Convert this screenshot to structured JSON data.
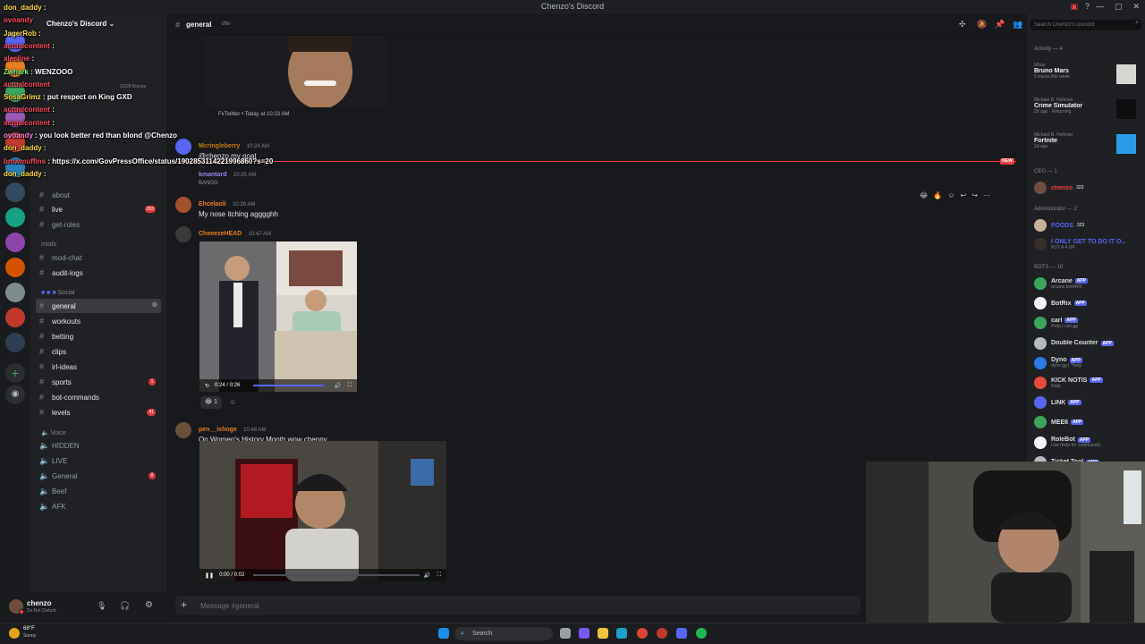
{
  "window": {
    "title": "Chenzo's Discord",
    "controls": [
      "—",
      "▢",
      "✕"
    ]
  },
  "server": {
    "name": "Chenzo's Discord",
    "boost_label": "12/28 Boosts"
  },
  "sidebar": {
    "categories": {
      "mods": "mods",
      "social": "Social",
      "voice": "Voice"
    },
    "top_channels": [
      {
        "name": "about"
      },
      {
        "name": "live",
        "badge": "293"
      },
      {
        "name": "get-roles"
      }
    ],
    "mod_channels": [
      {
        "name": "mod-chat"
      },
      {
        "name": "audit-logs"
      }
    ],
    "social_channels": [
      {
        "name": "general",
        "active": true
      },
      {
        "name": "workouts"
      },
      {
        "name": "betting"
      },
      {
        "name": "clips"
      },
      {
        "name": "irl-ideas"
      },
      {
        "name": "sports",
        "badge": "1"
      },
      {
        "name": "bot-commands"
      },
      {
        "name": "levels",
        "badge": "41"
      }
    ],
    "voice_channels": [
      {
        "name": "HIDDEN"
      },
      {
        "name": "LIVE"
      },
      {
        "name": "General",
        "badge": "8"
      },
      {
        "name": "Beef"
      },
      {
        "name": "AFK"
      }
    ]
  },
  "user_panel": {
    "username": "chenzo",
    "status": "Do Not Disturb"
  },
  "chat": {
    "channel": "general",
    "topic": "dfw",
    "embed_footer": "FxTwitter • Today at 10:23 AM",
    "new_tag": "NEW",
    "messages": [
      {
        "author": "Mcringleberry",
        "time": "10:24 AM",
        "text": "@chenzo my goat",
        "color": "#c27c0e"
      },
      {
        "author": "kmantard",
        "time": "10:25 AM",
        "text": "BANGG",
        "color": "#9b84ee"
      },
      {
        "author": "Ehcelaoli",
        "time": "10:26 AM",
        "text": "My nose itching agggghh",
        "color": "#e67e22"
      },
      {
        "author": "CheeezeHEAD",
        "time": "10:47 AM",
        "text": "",
        "color": "#e67e22"
      },
      {
        "author": "pen__ishoge",
        "time": "10:48 AM",
        "text": "On Women's History Month wow chenny",
        "color": "#e67e22"
      }
    ],
    "video1": {
      "time": "0:24 / 0:26",
      "progress": 0.92
    },
    "reaction": {
      "emoji": "😂",
      "count": "1"
    },
    "video2": {
      "time": "0:00 / 0:02",
      "progress": 0.0
    },
    "composer_placeholder": "Message #general"
  },
  "members": {
    "search_placeholder": "Search Chenzo's Discord",
    "activity_header": "Activity — 4",
    "activity": [
      {
        "name": "Mbae",
        "title": "Bruno Mars",
        "sub": "5 tracks this week"
      },
      {
        "name": "Michael R. Hellman",
        "title": "Crime Simulator",
        "sub": "2d ago · Returning"
      },
      {
        "name": "Michael R. Hellman",
        "title": "Fortnite",
        "sub": "2d ago"
      }
    ],
    "ceo_header": "CEO — 1",
    "ceo": [
      {
        "name": "chenzo",
        "badge": "323",
        "color": "#f23f43"
      }
    ],
    "admin_header": "Administrator — 2",
    "admins": [
      {
        "name": "FOODS",
        "badge": "323",
        "color": "#5865f2"
      },
      {
        "name": "I ONLY GET TO DO IT O...",
        "sub": "PUT A 4 UP",
        "color": "#5865f2"
      }
    ],
    "bots_header": "BOTS — 10",
    "bots": [
      {
        "name": "Arcane",
        "sub": "arcane.bot/AFK",
        "tag": "APP"
      },
      {
        "name": "BotRix",
        "sub": "",
        "tag": "APP"
      },
      {
        "name": "carl",
        "sub": "/help | carl.gg",
        "tag": "APP"
      },
      {
        "name": "Double Counter",
        "sub": "",
        "tag": "APP"
      },
      {
        "name": "Dyno",
        "sub": "dyno.gg | ?help",
        "tag": "APP"
      },
      {
        "name": "KICK NOTIS",
        "sub": "/help",
        "tag": "APP"
      },
      {
        "name": "LINK",
        "sub": "",
        "tag": "APP"
      },
      {
        "name": "MEE6",
        "sub": "",
        "tag": "APP"
      },
      {
        "name": "RoleBot",
        "sub": "Use /help for commands!",
        "tag": "APP"
      },
      {
        "name": "Ticket Tool",
        "sub": "",
        "tag": "APP"
      }
    ]
  },
  "stream_chat": [
    {
      "user": "don_daddy",
      "text": ":",
      "color": "yellow"
    },
    {
      "user": "ovoandy",
      "text": "",
      "color": "red"
    },
    {
      "user": "JagerRob",
      "text": ":",
      "color": "yellow"
    },
    {
      "user": "actualcontent",
      "text": ":",
      "color": "red"
    },
    {
      "user": "alecline",
      "text": ":",
      "color": "red"
    },
    {
      "user": "Zwhark",
      "text": ": WENZOOO",
      "color": "green"
    },
    {
      "user": "actualcontent",
      "text": "",
      "color": "red"
    },
    {
      "user": "SosaGrimz",
      "text": ": put respect on King GXD",
      "color": "yellow"
    },
    {
      "user": "actualcontent",
      "text": ":",
      "color": "red"
    },
    {
      "user": "actualcontent",
      "text": ":",
      "color": "red"
    },
    {
      "user": "ovoandy",
      "text": ": you look better red than blond @Chenzo",
      "color": "pink"
    },
    {
      "user": "don_daddy",
      "text": ":",
      "color": "yellow"
    },
    {
      "user": "bmwmuffins",
      "text": ": https://x.com/GovPressOffice/status/1902853114221996860?s=20",
      "color": "red"
    },
    {
      "user": "don_daddy",
      "text": ":",
      "color": "yellow"
    }
  ],
  "taskbar": {
    "weather_temp": "68°F",
    "weather_desc": "Sunny",
    "search_label": "Search"
  }
}
